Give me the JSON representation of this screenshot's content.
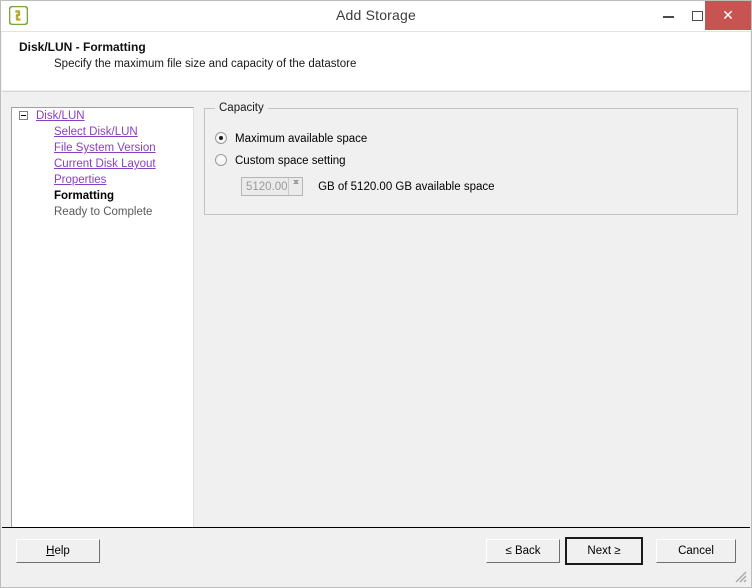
{
  "window": {
    "title": "Add Storage",
    "app_icon": "vsphere-link-icon",
    "controls": {
      "minimize": "minimize-icon",
      "maximize": "maximize-icon",
      "close": "✕"
    }
  },
  "header": {
    "title": "Disk/LUN - Formatting",
    "subtitle": "Specify the maximum file size and capacity of the datastore"
  },
  "sidebar": {
    "items": [
      {
        "label": "Disk/LUN",
        "state": "link",
        "level": 0,
        "expander": "collapse-box"
      },
      {
        "label": "Select Disk/LUN",
        "state": "link",
        "level": 1
      },
      {
        "label": "File System Version",
        "state": "link",
        "level": 1
      },
      {
        "label": "Current Disk Layout",
        "state": "link",
        "level": 1
      },
      {
        "label": "Properties",
        "state": "link",
        "level": 1
      },
      {
        "label": "Formatting",
        "state": "current",
        "level": 1
      },
      {
        "label": "Ready to Complete",
        "state": "plain",
        "level": 1
      }
    ]
  },
  "capacity": {
    "legend": "Capacity",
    "options": [
      {
        "label": "Maximum available space",
        "selected": true
      },
      {
        "label": "Custom space setting",
        "selected": false
      }
    ],
    "spinner": {
      "value": "5120.00",
      "enabled": false,
      "suffix": "GB of 5120.00 GB available space"
    }
  },
  "footer": {
    "help": "Help",
    "help_accesskey": "H",
    "back": "≤ Back",
    "next": "Next ≥",
    "cancel": "Cancel"
  },
  "colors": {
    "link": "#8a3fc0",
    "close_button": "#c75450",
    "dialog_background": "#f0f0f0",
    "panel_white": "#ffffff"
  }
}
